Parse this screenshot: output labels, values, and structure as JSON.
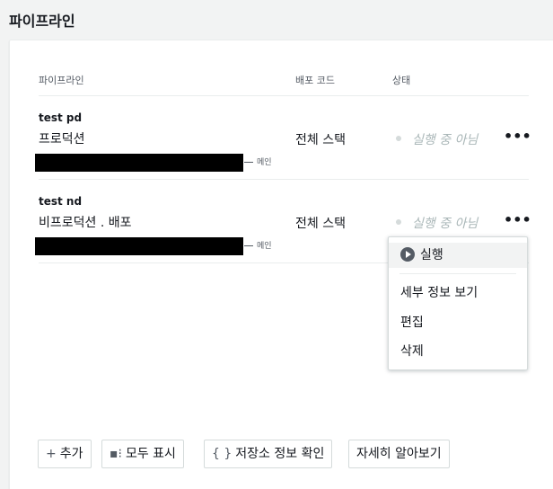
{
  "page": {
    "title": "파이프라인"
  },
  "table": {
    "headers": {
      "pipeline": "파이프라인",
      "deploy_code": "배포 코드",
      "status": "상태"
    },
    "rows": [
      {
        "name": "test pd",
        "stage": "프로덕션",
        "branch": "메인",
        "deploy_code": "전체 스택",
        "status": "실행 중 아님"
      },
      {
        "name": "test nd",
        "stage": "비프로덕션 . 배포",
        "branch": "메인",
        "deploy_code": "전체 스택",
        "status": "실행 중 아님"
      }
    ],
    "more_glyph": "•••"
  },
  "menu": {
    "items": [
      "실행",
      "세부 정보 보기",
      "편집",
      "삭제"
    ],
    "icons": {
      "run": "play-circle-icon"
    }
  },
  "buttons": {
    "add": {
      "icon": "+",
      "label": "추가"
    },
    "show_all": {
      "icon": "▪⁝",
      "label": "모두 표시"
    },
    "repo": {
      "icon": "{ }",
      "label": "저장소 정보 확인"
    },
    "learn": {
      "label": "자세히 알아보기"
    }
  }
}
